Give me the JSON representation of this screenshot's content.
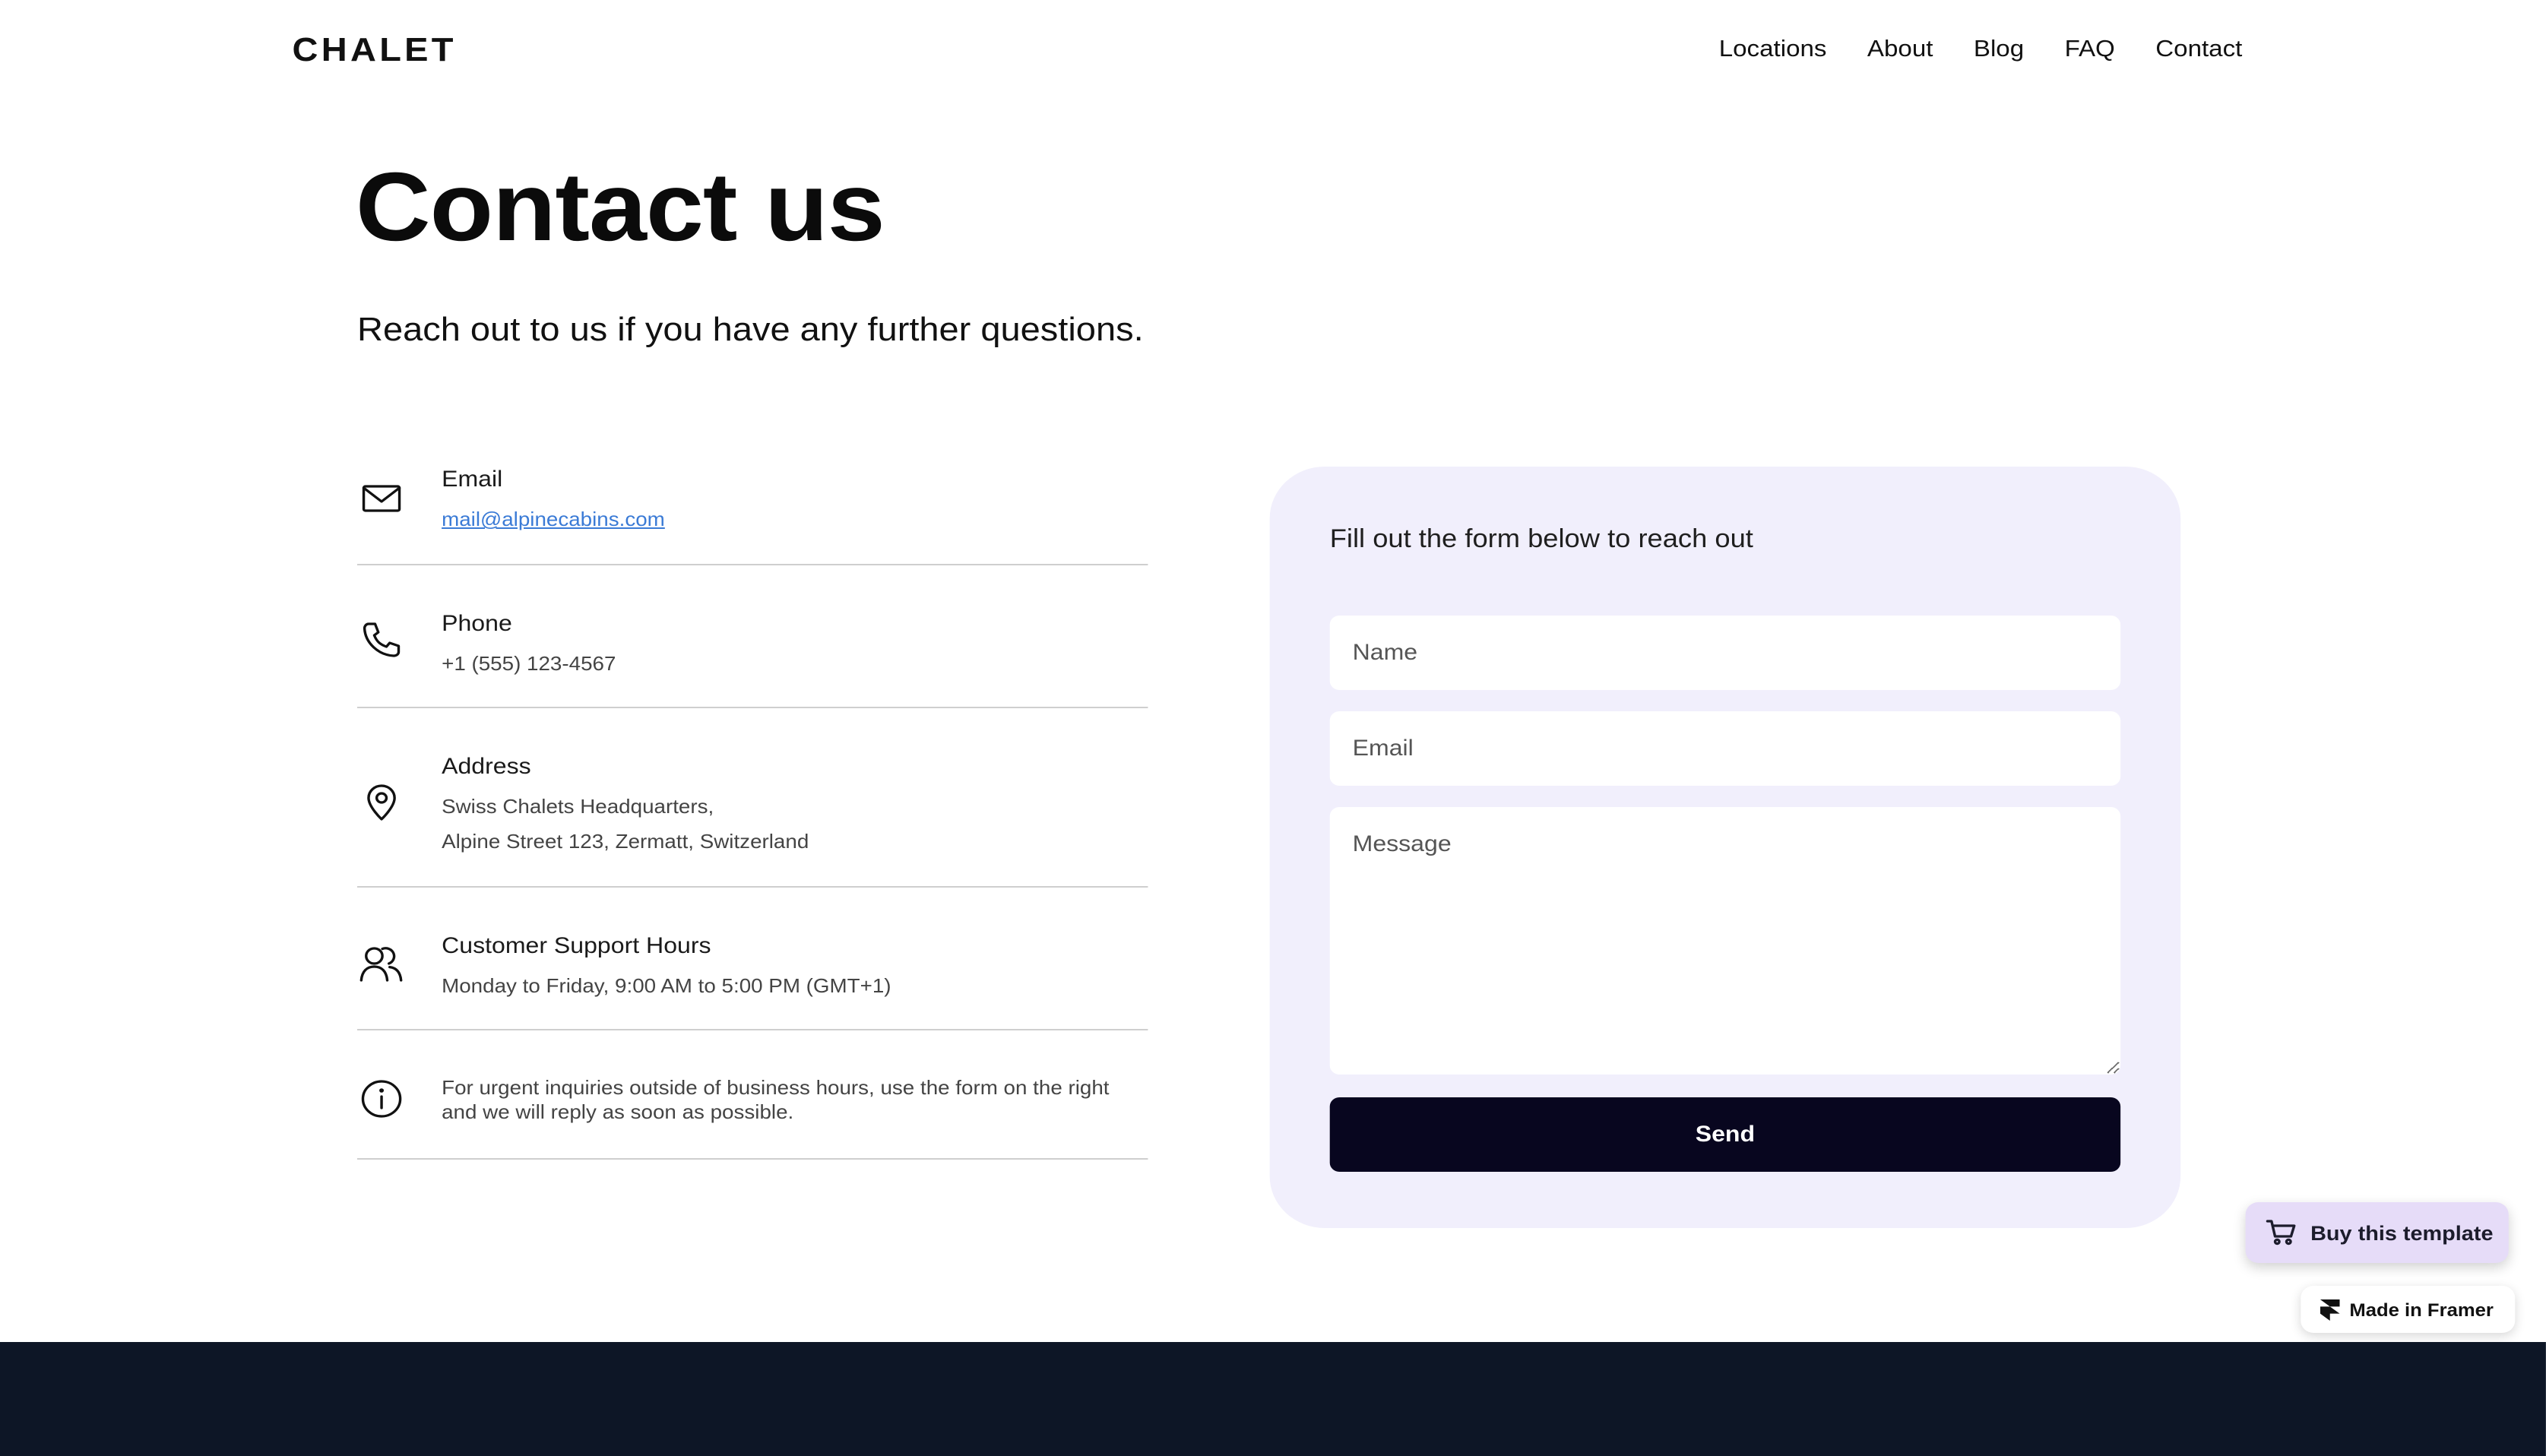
{
  "header": {
    "logo": "CHALET",
    "nav": [
      "Locations",
      "About",
      "Blog",
      "FAQ",
      "Contact"
    ]
  },
  "hero": {
    "title": "Contact us",
    "subtitle": "Reach out to us if you have any further questions."
  },
  "contact_info": {
    "email": {
      "label": "Email",
      "value": "mail@alpinecabins.com",
      "icon": "mail-icon"
    },
    "phone": {
      "label": "Phone",
      "value": "+1 (555) 123-4567",
      "icon": "phone-icon"
    },
    "address": {
      "label": "Address",
      "line1": "Swiss Chalets Headquarters,",
      "line2": "Alpine Street 123, Zermatt, Switzerland",
      "icon": "location-pin-icon"
    },
    "support": {
      "label": "Customer Support Hours",
      "value": "Monday to Friday, 9:00 AM to 5:00 PM (GMT+1)",
      "icon": "users-icon"
    },
    "note": {
      "text": "For urgent inquiries outside of business hours, use the form on the right and we will reply as soon as possible.",
      "icon": "info-icon"
    }
  },
  "form": {
    "heading": "Fill out the form below to reach out",
    "name_placeholder": "Name",
    "email_placeholder": "Email",
    "message_placeholder": "Message",
    "send_label": "Send"
  },
  "badges": {
    "buy_label": "Buy this template",
    "framer_label": "Made in Framer"
  },
  "colors": {
    "form_background": "#f1effc",
    "button_background": "#08061f",
    "link": "#3b7bd6",
    "buy_badge_background": "#e6dcf8",
    "footer_background": "#0d1626"
  }
}
